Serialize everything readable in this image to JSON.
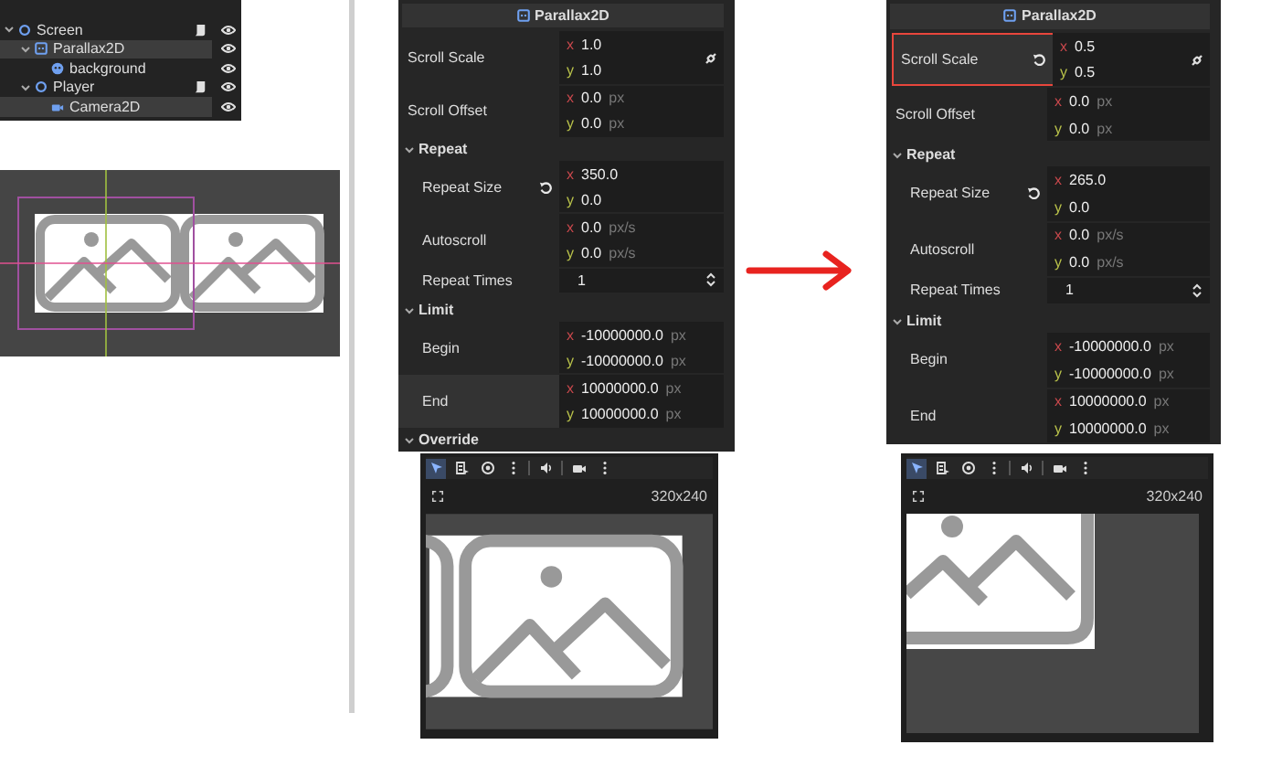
{
  "scene_tree": {
    "items": [
      {
        "name": "Screen",
        "kind": "node",
        "script": true,
        "selected": false,
        "expanded": true,
        "children": [
          {
            "name": "Parallax2D",
            "kind": "parallax",
            "script": false,
            "selected": true,
            "expanded": true,
            "children": [
              {
                "name": "background",
                "kind": "sprite",
                "script": false,
                "selected": false
              }
            ]
          },
          {
            "name": "Player",
            "kind": "node",
            "script": true,
            "selected": false,
            "expanded": true,
            "children": [
              {
                "name": "Camera2D",
                "kind": "camera",
                "script": false,
                "selected": true
              }
            ]
          }
        ]
      }
    ]
  },
  "inspectors": [
    {
      "title": "Parallax2D",
      "rows": [
        {
          "kind": "vector",
          "label": "Scroll Scale",
          "link": true,
          "modified": false,
          "highlighted": false,
          "components": [
            {
              "axis": "x",
              "value": "1.0"
            },
            {
              "axis": "y",
              "value": "1.0"
            }
          ]
        },
        {
          "kind": "vector",
          "label": "Scroll Offset",
          "components": [
            {
              "axis": "x",
              "value": "0.0",
              "unit": "px"
            },
            {
              "axis": "y",
              "value": "0.0",
              "unit": "px"
            }
          ]
        },
        {
          "kind": "section",
          "label": "Repeat",
          "expanded": true,
          "children": [
            {
              "kind": "vector",
              "label": "Repeat Size",
              "modified": true,
              "components": [
                {
                  "axis": "x",
                  "value": "350.0"
                },
                {
                  "axis": "y",
                  "value": "0.0"
                }
              ]
            },
            {
              "kind": "vector",
              "label": "Autoscroll",
              "components": [
                {
                  "axis": "x",
                  "value": "0.0",
                  "unit": "px/s"
                },
                {
                  "axis": "y",
                  "value": "0.0",
                  "unit": "px/s"
                }
              ]
            },
            {
              "kind": "spin",
              "label": "Repeat Times",
              "value": "1"
            }
          ]
        },
        {
          "kind": "section",
          "label": "Limit",
          "expanded": true,
          "children": [
            {
              "kind": "vector",
              "label": "Begin",
              "components": [
                {
                  "axis": "x",
                  "value": "-10000000.0",
                  "unit": "px"
                },
                {
                  "axis": "y",
                  "value": "-10000000.0",
                  "unit": "px"
                }
              ]
            },
            {
              "kind": "vector",
              "label": "End",
              "hovered": true,
              "components": [
                {
                  "axis": "x",
                  "value": "10000000.0",
                  "unit": "px"
                },
                {
                  "axis": "y",
                  "value": "10000000.0",
                  "unit": "px"
                }
              ]
            }
          ]
        },
        {
          "kind": "section",
          "label": "Override",
          "expanded": true,
          "children": []
        }
      ]
    },
    {
      "title": "Parallax2D",
      "rows": [
        {
          "kind": "vector",
          "label": "Scroll Scale",
          "link": true,
          "modified": true,
          "highlighted": true,
          "components": [
            {
              "axis": "x",
              "value": "0.5"
            },
            {
              "axis": "y",
              "value": "0.5"
            }
          ]
        },
        {
          "kind": "vector",
          "label": "Scroll Offset",
          "components": [
            {
              "axis": "x",
              "value": "0.0",
              "unit": "px"
            },
            {
              "axis": "y",
              "value": "0.0",
              "unit": "px"
            }
          ]
        },
        {
          "kind": "section",
          "label": "Repeat",
          "expanded": true,
          "children": [
            {
              "kind": "vector",
              "label": "Repeat Size",
              "modified": true,
              "components": [
                {
                  "axis": "x",
                  "value": "265.0"
                },
                {
                  "axis": "y",
                  "value": "0.0"
                }
              ]
            },
            {
              "kind": "vector",
              "label": "Autoscroll",
              "components": [
                {
                  "axis": "x",
                  "value": "0.0",
                  "unit": "px/s"
                },
                {
                  "axis": "y",
                  "value": "0.0",
                  "unit": "px/s"
                }
              ]
            },
            {
              "kind": "spin",
              "label": "Repeat Times",
              "value": "1"
            }
          ]
        },
        {
          "kind": "section",
          "label": "Limit",
          "expanded": true,
          "children": [
            {
              "kind": "vector",
              "label": "Begin",
              "components": [
                {
                  "axis": "x",
                  "value": "-10000000.0",
                  "unit": "px"
                },
                {
                  "axis": "y",
                  "value": "-10000000.0",
                  "unit": "px"
                }
              ]
            },
            {
              "kind": "vector",
              "label": "End",
              "components": [
                {
                  "axis": "x",
                  "value": "10000000.0",
                  "unit": "px"
                },
                {
                  "axis": "y",
                  "value": "10000000.0",
                  "unit": "px"
                }
              ]
            }
          ]
        }
      ]
    }
  ],
  "viewports": [
    {
      "size": "320x240",
      "kind": "tiled",
      "tools": [
        {
          "kind": "select",
          "selected": true
        },
        {
          "kind": "list",
          "selected": false
        },
        {
          "kind": "target",
          "selected": false
        },
        {
          "kind": "more",
          "selected": false
        },
        {
          "kind": "audio",
          "selected": false
        },
        {
          "kind": "camera",
          "selected": false
        },
        {
          "kind": "more",
          "selected": false
        }
      ]
    },
    {
      "size": "320x240",
      "kind": "scaled",
      "tools": [
        {
          "kind": "select",
          "selected": true
        },
        {
          "kind": "list",
          "selected": false
        },
        {
          "kind": "target",
          "selected": false
        },
        {
          "kind": "more",
          "selected": false
        },
        {
          "kind": "audio",
          "selected": false
        },
        {
          "kind": "camera",
          "selected": false
        },
        {
          "kind": "more",
          "selected": false
        }
      ]
    }
  ]
}
